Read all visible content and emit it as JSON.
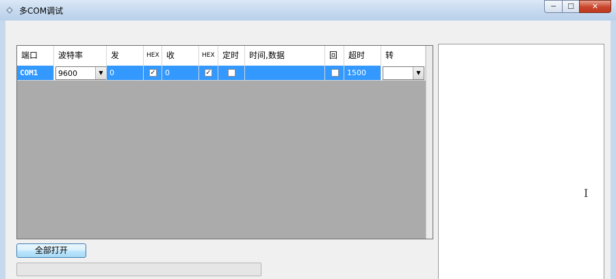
{
  "window": {
    "title": "多COM调试",
    "icons": [
      "app-icon",
      "minimize-icon",
      "maximize-icon",
      "close-icon"
    ]
  },
  "grid": {
    "columns": [
      "端口",
      "波特率",
      "发",
      "HEX",
      "收",
      "HEX",
      "定时",
      "时间,数据",
      "回",
      "超时",
      "转"
    ],
    "rows": [
      {
        "port": "COM1",
        "baud": "9600",
        "send": "0",
        "send_hex": true,
        "recv": "0",
        "recv_hex": true,
        "timed": false,
        "time_data": "",
        "echo": false,
        "timeout": "1500",
        "forward": ""
      }
    ],
    "selected_row": 0
  },
  "buttons": {
    "open_all": "全部打开"
  },
  "colors": {
    "selection": "#3399ff",
    "grid_background": "#ababab",
    "window_frame": "#c5d8ee"
  }
}
